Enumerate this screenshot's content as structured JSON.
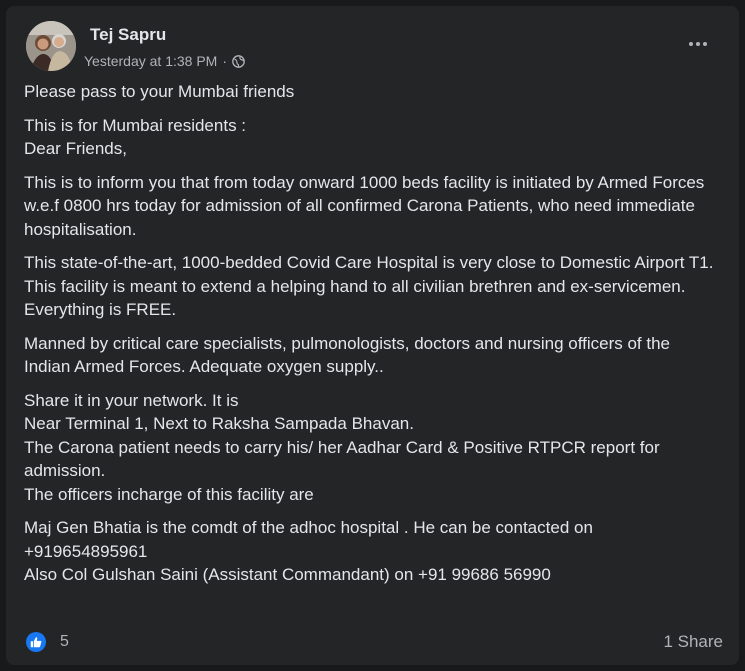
{
  "post": {
    "author": "Tej Sapru",
    "timestamp": "Yesterday at 1:38 PM",
    "separator": "·",
    "privacy_icon": "globe-icon",
    "more_icon": "more-options-icon",
    "paragraphs": [
      "Please pass to your Mumbai friends",
      "This is for Mumbai residents :\nDear Friends,",
      "This is to inform you that from today onward 1000 beds facility is initiated by Armed Forces w.e.f 0800 hrs today for admission of all confirmed Carona Patients, who need immediate hospitalisation.",
      "This state-of-the-art, 1000-bedded Covid Care Hospital is very close to Domestic Airport T1.\nThis facility is meant to extend a helping hand to all civilian brethren and ex-servicemen.  Everything is FREE.",
      "Manned by critical care specialists, pulmonologists, doctors and nursing officers of the Indian Armed Forces. Adequate oxygen supply..",
      "Share it in your network. It is\nNear Terminal 1, Next to Raksha Sampada Bhavan.\nThe Carona patient needs to carry his/ her Aadhar Card & Positive RTPCR report for admission.\nThe officers incharge of this facility are",
      "Maj Gen Bhatia is the comdt of the adhoc hospital . He can be contacted on +919654895961\nAlso Col Gulshan Saini (Assistant Commandant)  on +91 99686 56990"
    ]
  },
  "footer": {
    "reaction_icon": "like-icon",
    "reaction_count": "5",
    "share_count": "1 Share"
  },
  "colors": {
    "background": "#18191a",
    "card": "#242526",
    "text_primary": "#e4e6eb",
    "text_secondary": "#b0b3b8",
    "like_blue": "#1877f2"
  }
}
